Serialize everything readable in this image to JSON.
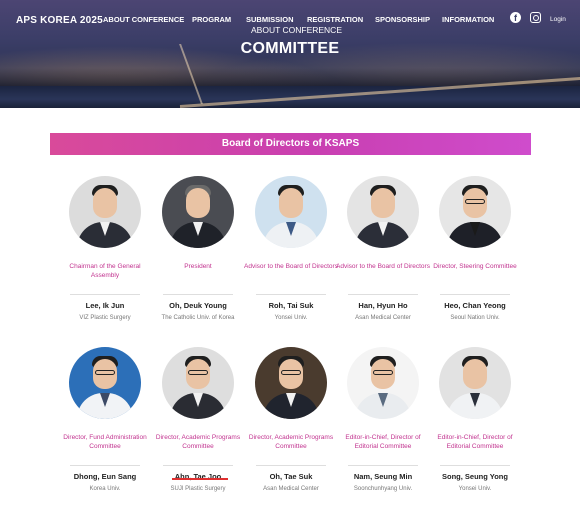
{
  "header": {
    "logo": "APS KOREA 2025",
    "nav": [
      {
        "label": "ABOUT CONFERENCE"
      },
      {
        "label": "PROGRAM"
      },
      {
        "label": "SUBMISSION"
      },
      {
        "label": "REGISTRATION"
      },
      {
        "label": "SPONSORSHIP"
      },
      {
        "label": "INFORMATION"
      }
    ],
    "sub_label": "ABOUT CONFERENCE",
    "login": "Login",
    "facebook_glyph": "f",
    "icons": [
      "facebook-icon",
      "instagram-icon"
    ]
  },
  "hero": {
    "title": "COMMITTEE"
  },
  "section": {
    "title": "Board of Directors of KSAPS"
  },
  "colors": {
    "accent": "#c93fb1",
    "role_text": "#c2338f",
    "hero_dark": "#2e3556"
  },
  "people": [
    {
      "role": "Chairman of the General Assembly",
      "name": "Lee, Ik Jun",
      "affiliation": "VIZ Plastic Surgery"
    },
    {
      "role": "President",
      "name": "Oh, Deuk Young",
      "affiliation": "The Catholic Univ. of Korea"
    },
    {
      "role": "Advisor to the Board of Directors",
      "name": "Roh, Tai Suk",
      "affiliation": "Yonsei Univ."
    },
    {
      "role": "Advisor to the Board of Directors",
      "name": "Han, Hyun Ho",
      "affiliation": "Asan Medical Center"
    },
    {
      "role": "Director, Steering Committee",
      "name": "Heo, Chan Yeong",
      "affiliation": "Seoul Nation Univ."
    },
    {
      "role": "Director, Fund Administration Committee",
      "name": "Dhong, Eun Sang",
      "affiliation": "Korea Univ."
    },
    {
      "role": "Director, Academic Programs Committee",
      "name": "Ahn, Tae Joo",
      "affiliation": "SUJI Plastic Surgery"
    },
    {
      "role": "Director, Academic Programs Committee",
      "name": "Oh, Tae Suk",
      "affiliation": "Asan Medical Center"
    },
    {
      "role": "Editor-in-Chief, Director of Editorial Committee",
      "name": "Nam, Seung Min",
      "affiliation": "Soonchunhyang Univ."
    },
    {
      "role": "Editor-in-Chief, Director of Editorial Committee",
      "name": "Song, Seung Yong",
      "affiliation": "Yonsei Univ."
    }
  ]
}
